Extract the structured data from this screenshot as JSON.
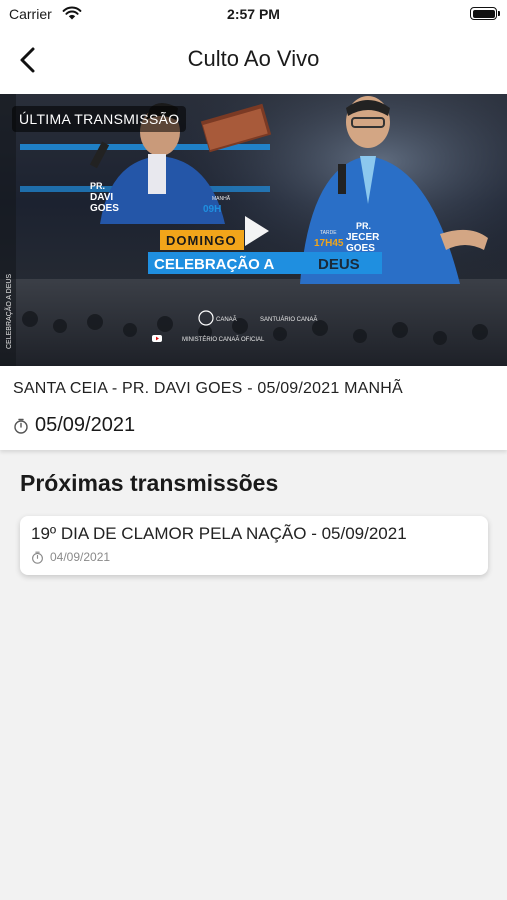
{
  "status_bar": {
    "carrier": "Carrier",
    "time": "2:57 PM"
  },
  "nav": {
    "title": "Culto Ao Vivo"
  },
  "last_broadcast": {
    "badge": "ÚLTIMA TRANSMISSÃO",
    "title": "SANTA CEIA - PR. DAVI GOES - 05/09/2021 MANHÃ",
    "date": "05/09/2021",
    "thumbnail": {
      "pastor_left_title": "PR.",
      "pastor_left_first": "DAVI",
      "pastor_left_last": "GOES",
      "time_left_label": "MANHÃ",
      "time_left": "09H",
      "day": "DOMINGO",
      "event": "CELEBRAÇÃO A DEUS",
      "event_plain": "CELEBRAÇÃO A",
      "event_accent": "DEUS",
      "time_right_label": "TARDE",
      "time_right": "17H45",
      "pastor_right_title": "PR.",
      "pastor_right_first": "JECER",
      "pastor_right_last": "GOES",
      "org": "CANAÃ",
      "venue": "SANTUÁRIO CANAÃ",
      "youtube": "MINISTÉRIO CANAÃ OFICIAL",
      "side_text": "CELEBRAÇÃO A DEUS"
    }
  },
  "upcoming": {
    "heading": "Próximas transmissões",
    "items": [
      {
        "title": "19º DIA DE CLAMOR PELA NAÇÃO - 05/09/2021",
        "date": "04/09/2021"
      }
    ]
  },
  "colors": {
    "accent_orange": "#f2a51a",
    "accent_blue": "#1f8fe0",
    "background": "#f2f2f2"
  }
}
